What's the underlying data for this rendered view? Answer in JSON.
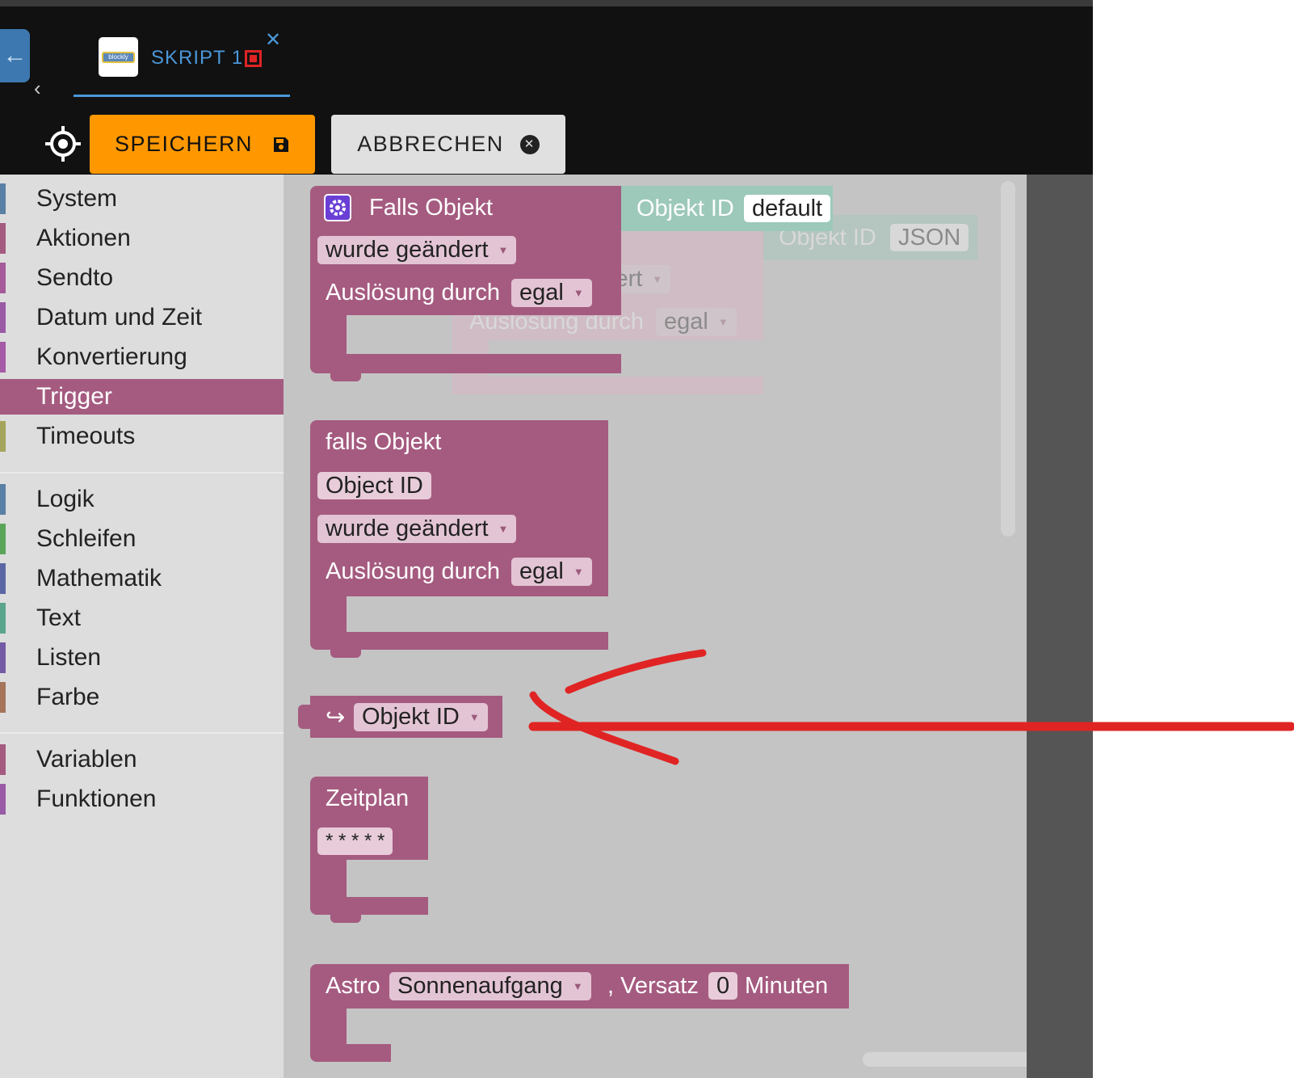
{
  "tab": {
    "title": "SKRIPT 1",
    "logo_text": "blockly"
  },
  "toolbar": {
    "save_label": "SPEICHERN",
    "cancel_label": "ABBRECHEN"
  },
  "sidebar": {
    "group1": [
      {
        "label": "System",
        "color": "#5b80a5"
      },
      {
        "label": "Aktionen",
        "color": "#a55b80"
      },
      {
        "label": "Sendto",
        "color": "#a55b9a"
      },
      {
        "label": "Datum und Zeit",
        "color": "#9a5ba5"
      },
      {
        "label": "Konvertierung",
        "color": "#a55ba5"
      },
      {
        "label": "Trigger",
        "color": "#a55b80"
      },
      {
        "label": "Timeouts",
        "color": "#a5a55b"
      }
    ],
    "group2": [
      {
        "label": "Logik",
        "color": "#5b80a5"
      },
      {
        "label": "Schleifen",
        "color": "#5ba55b"
      },
      {
        "label": "Mathematik",
        "color": "#5b67a5"
      },
      {
        "label": "Text",
        "color": "#5ba58c"
      },
      {
        "label": "Listen",
        "color": "#745ba5"
      },
      {
        "label": "Farbe",
        "color": "#a5745b"
      }
    ],
    "group3": [
      {
        "label": "Variablen",
        "color": "#a55b80"
      },
      {
        "label": "Funktionen",
        "color": "#995ba5"
      }
    ],
    "selected": "Trigger"
  },
  "blocks": {
    "b1": {
      "title": "Falls Objekt",
      "event": "wurde geändert",
      "trigger_label": "Auslösung durch",
      "trigger_value": "egal",
      "objid_label": "Objekt ID",
      "objid_value": "default"
    },
    "ghost": {
      "title_frag": "kt",
      "event_frag": "iert",
      "trigger_label": "Auslösung durch",
      "trigger_value": "egal",
      "objid_label": "Objekt ID",
      "objid_value": "JSON"
    },
    "b2": {
      "title": "falls Objekt",
      "object_field": "Object ID",
      "event": "wurde geändert",
      "trigger_label": "Auslösung durch",
      "trigger_value": "egal"
    },
    "b3": {
      "arrow": "↪",
      "value": "Objekt ID"
    },
    "b4": {
      "title": "Zeitplan",
      "cron": "* * * * *"
    },
    "b5": {
      "title": "Astro",
      "event": "Sonnenaufgang",
      "offset_label": ", Versatz",
      "offset_value": "0",
      "unit": "Minuten"
    }
  },
  "colors": {
    "accent_save": "#ff9800",
    "block_trigger": "#a55b80",
    "tab_blue": "#4a97d8",
    "annotation_red": "#e02424"
  }
}
